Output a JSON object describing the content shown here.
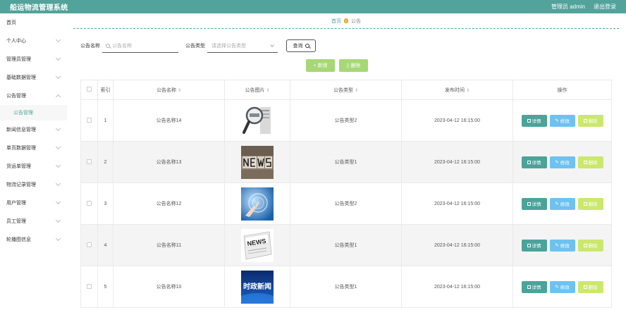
{
  "header": {
    "title": "船运物流管理系统",
    "user": "管理员 admin",
    "logout": "退出登录"
  },
  "sidebar": {
    "items": [
      {
        "label": "首页",
        "expandable": false
      },
      {
        "label": "个人中心",
        "expandable": true
      },
      {
        "label": "管理员管理",
        "expandable": true
      },
      {
        "label": "基础数据管理",
        "expandable": true
      },
      {
        "label": "公告管理",
        "expandable": true,
        "open": true
      },
      {
        "label": "新闻信息管理",
        "expandable": true
      },
      {
        "label": "单页数据管理",
        "expandable": true
      },
      {
        "label": "货运单管理",
        "expandable": true
      },
      {
        "label": "物流记录管理",
        "expandable": true
      },
      {
        "label": "用户管理",
        "expandable": true
      },
      {
        "label": "员工管理",
        "expandable": true
      },
      {
        "label": "轮播图信息",
        "expandable": true
      }
    ],
    "subitem": "公告管理"
  },
  "breadcrumb": {
    "home": "首页",
    "current": "公告"
  },
  "search": {
    "name_label": "公告名称",
    "name_placeholder": "公告名称",
    "type_label": "公告类型",
    "type_placeholder": "请选择公告类型",
    "query_label": "查询"
  },
  "actions": {
    "add": "新增",
    "delete": "删除"
  },
  "table": {
    "headers": [
      "索引",
      "公告名称",
      "公告图片",
      "公告类型",
      "发布时间",
      "操作"
    ],
    "rows": [
      {
        "index": "1",
        "name": "公告名称14",
        "type": "公告类型2",
        "time": "2023-04-12 16:15:00"
      },
      {
        "index": "2",
        "name": "公告名称13",
        "type": "公告类型1",
        "time": "2023-04-12 16:15:00"
      },
      {
        "index": "3",
        "name": "公告名称12",
        "type": "公告类型2",
        "time": "2023-04-12 16:15:00"
      },
      {
        "index": "4",
        "name": "公告名称11",
        "type": "公告类型1",
        "time": "2023-04-12 16:15:00"
      },
      {
        "index": "5",
        "name": "公告名称10",
        "type": "公告类型1",
        "time": "2023-04-12 16:15:00"
      }
    ],
    "row_actions": {
      "detail": "详情",
      "edit": "修改",
      "delete": "删除"
    }
  },
  "images": {
    "img4_text": "NEWS",
    "img5_text": "时政新闻"
  },
  "colors": {
    "accent": "#52a39b",
    "green_btn": "#a6d875",
    "blue_btn": "#6ec2f0",
    "lime_btn": "#cbe86d"
  }
}
